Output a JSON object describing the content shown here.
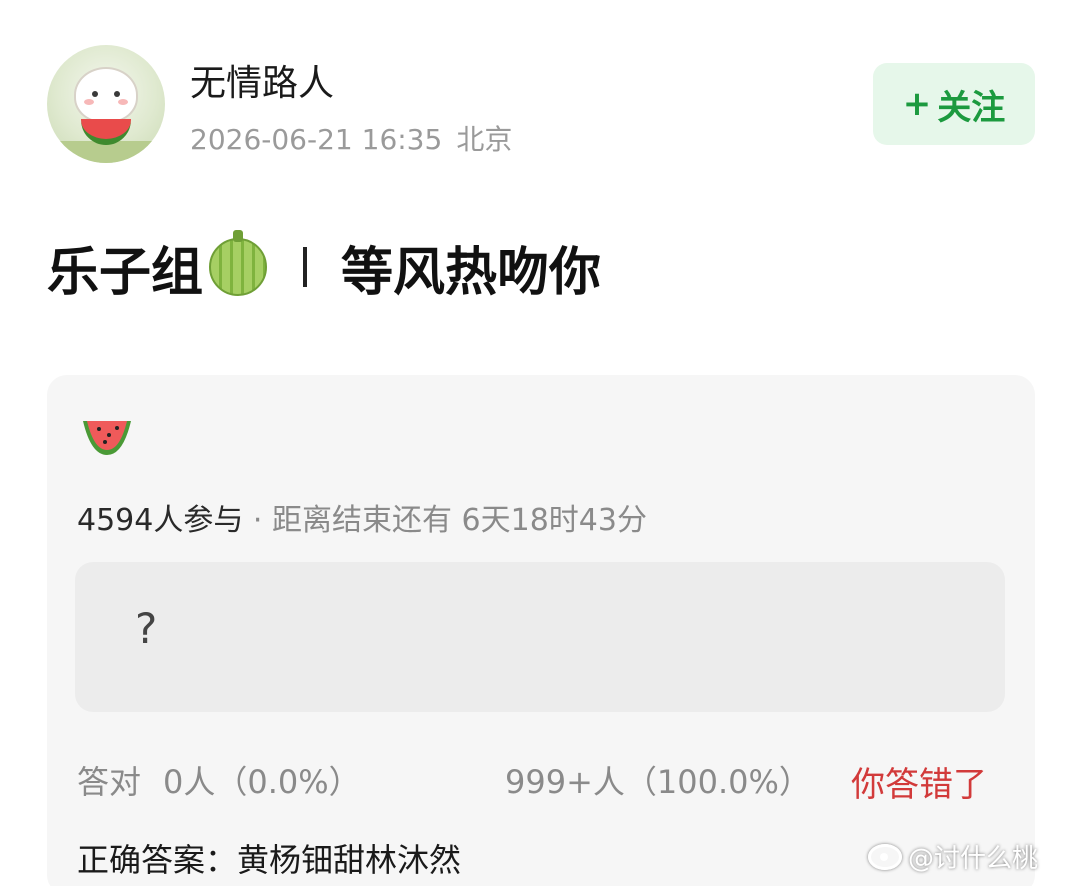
{
  "author": {
    "name": "无情路人",
    "date": "2026-06-21 16:35",
    "location": "北京",
    "avatar_icon": "cartoon-bear-eating-watermelon-avatar"
  },
  "follow_button": {
    "plus": "+",
    "label": "关注"
  },
  "post": {
    "title_prefix": "乐子组",
    "title_icon": "melon-icon",
    "title_separator": "|",
    "title_suffix": "等风热吻你"
  },
  "quiz": {
    "icon": "watermelon-icon",
    "participants": "4594人参与",
    "dot": " · ",
    "deadline_label": "距离结束还有",
    "deadline_value": "6天18时43分",
    "option_text": "?",
    "correct_label": "答对",
    "correct_stats": "0人（0.0%）",
    "wrong_stats": "999+人（100.0%）",
    "wrong_label": "你答错了",
    "answer_label": "正确答案：",
    "answer_value": "黄杨钿甜林沐然"
  },
  "watermark": {
    "text": "@讨什么桃",
    "icon": "weibo-icon"
  },
  "colors": {
    "follow_bg": "#e6f7ea",
    "follow_text": "#1c9a3f",
    "wrong_text": "#d23a3a",
    "card_bg": "#f6f6f6",
    "option_bg": "#ececec"
  }
}
